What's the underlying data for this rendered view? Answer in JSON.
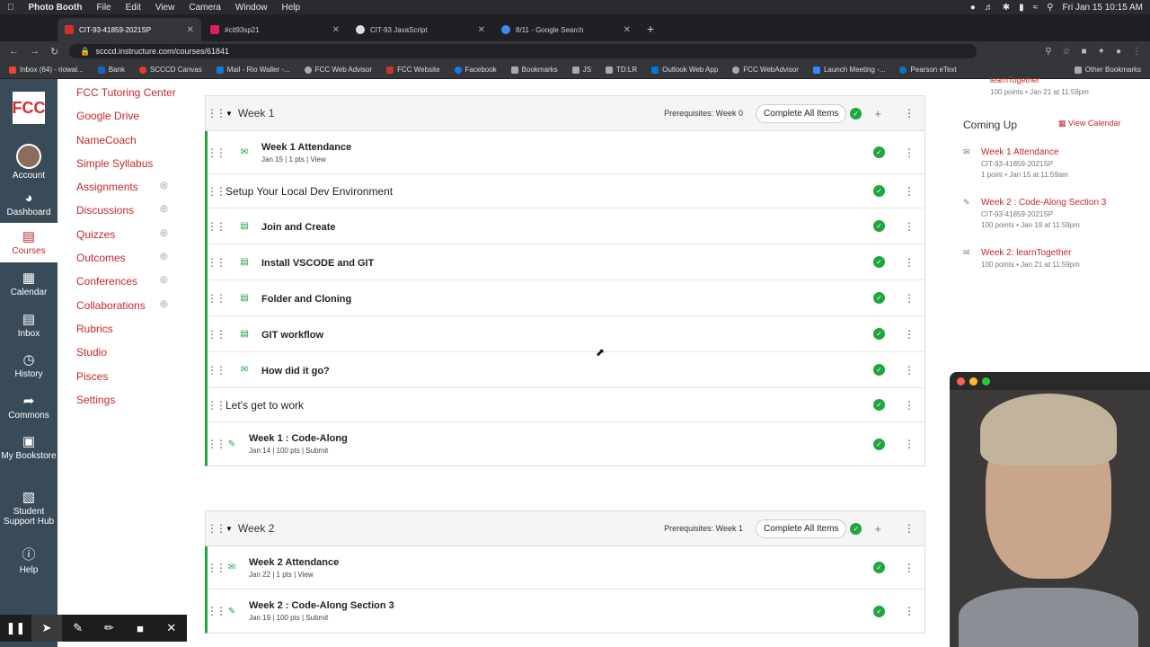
{
  "menubar": {
    "app": "Photo Booth",
    "items": [
      "File",
      "Edit",
      "View",
      "Camera",
      "Window",
      "Help"
    ],
    "clock": "Fri Jan 15  10:15 AM"
  },
  "tabs": [
    {
      "label": "CIT-93-41859-2021SP",
      "color": "#d32f2f"
    },
    {
      "label": "#cit93sp21",
      "color": "#e01e5a"
    },
    {
      "label": "CIT-93 JavaScript",
      "color": "#ffffff"
    },
    {
      "label": "8/11 - Google Search",
      "color": "#4285f4"
    }
  ],
  "address": {
    "url": "scccd.instructure.com/courses/61841"
  },
  "bookmarks": [
    "Inbox (64) - riowal...",
    "Bank",
    "SCCCD Canvas",
    "Mail - Rio Waller -...",
    "FCC Web Advisor",
    "FCC Website",
    "Facebook",
    "Bookmarks",
    "JS",
    "TD:LR",
    "Outlook Web App",
    "FCC WebAdvisor",
    "Launch Meeting -...",
    "Pearson eText"
  ],
  "bookmarks_other": "Other Bookmarks",
  "global_nav": {
    "logo": "FCC",
    "items": [
      "Account",
      "Dashboard",
      "Courses",
      "Calendar",
      "Inbox",
      "History",
      "Commons",
      "My Bookstore",
      "Student Support Hub",
      "Help"
    ]
  },
  "course_nav": [
    "FCC Tutoring Center",
    "Google Drive",
    "NameCoach",
    "Simple Syllabus",
    "Assignments",
    "Discussions",
    "Quizzes",
    "Outcomes",
    "Conferences",
    "Collaborations",
    "Rubrics",
    "Studio",
    "Pisces",
    "Settings"
  ],
  "module1": {
    "title": "Week 1",
    "prereq": "Prerequisites: Week 0",
    "complete": "Complete All Items",
    "items": [
      {
        "title": "Week 1 Attendance",
        "meta": "Jan 15  |  1 pts  |  View"
      },
      {
        "title": "Setup Your Local Dev Environment"
      },
      {
        "title": "Join and Create"
      },
      {
        "title": "Install VSCODE and GIT"
      },
      {
        "title": "Folder and Cloning"
      },
      {
        "title": "GIT workflow"
      },
      {
        "title": "How did it go?"
      },
      {
        "title": "Let's get to work"
      },
      {
        "title": "Week 1 : Code-Along",
        "meta": "Jan 14  |  100 pts  |  Submit"
      }
    ]
  },
  "module2": {
    "title": "Week 2",
    "prereq": "Prerequisites: Week 1",
    "complete": "Complete All Items",
    "items": [
      {
        "title": "Week 2 Attendance",
        "meta": "Jan 22  |  1 pts  |  View"
      },
      {
        "title": "Week 2 : Code-Along Section 3",
        "meta": "Jan 19  |  100 pts  |  Submit"
      }
    ]
  },
  "coming_up": {
    "top_partial_1": "learnTogether",
    "top_partial_2": "100 points • Jan 21 at 11:59pm",
    "title": "Coming Up",
    "view_calendar": "View Calendar",
    "items": [
      {
        "title": "Week 1 Attendance",
        "course": "CIT-93-41859-2021SP",
        "info": "1 point • Jan 15 at 11:59am"
      },
      {
        "title": "Week 2 : Code-Along Section 3",
        "course": "CIT-93-41859-2021SP",
        "info": "100 points • Jan 19 at 11:59pm"
      },
      {
        "title": "Week 2: learnTogether",
        "info": "100 points • Jan 21 at 11:59pm"
      }
    ]
  },
  "colors": {
    "accent": "#c62828",
    "nav_bg": "#394b58",
    "success": "#1fa63f"
  }
}
